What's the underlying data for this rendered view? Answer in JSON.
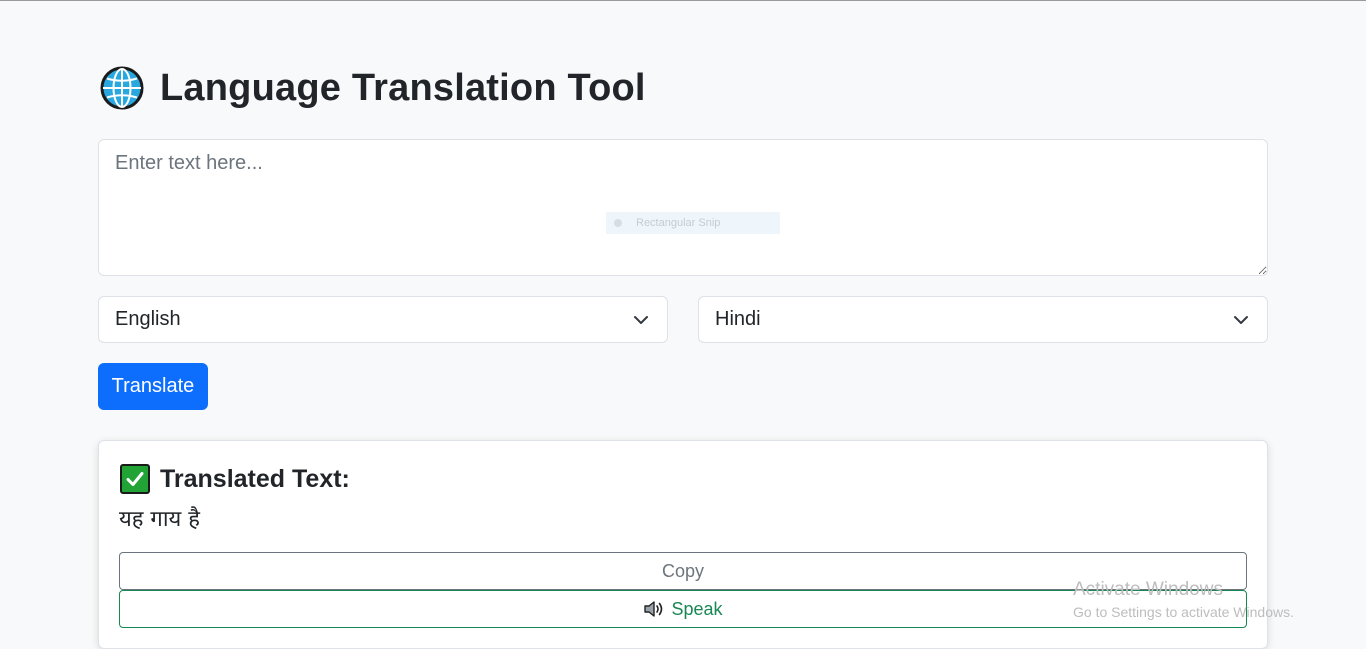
{
  "header": {
    "title": "Language Translation Tool",
    "icon": "globe-icon"
  },
  "input": {
    "placeholder": "Enter text here...",
    "value": ""
  },
  "snip_overlay": {
    "label": "Rectangular Snip"
  },
  "languages": {
    "source": "English",
    "target": "Hindi"
  },
  "actions": {
    "translate_label": "Translate"
  },
  "result": {
    "heading": "Translated Text:",
    "text": "यह गाय है",
    "copy_label": "Copy",
    "speak_label": "Speak"
  },
  "watermark": {
    "line1": "Activate Windows",
    "line2": "Go to Settings to activate Windows."
  },
  "colors": {
    "primary": "#0d6efd",
    "success": "#198754",
    "secondary": "#6c757d",
    "background": "#f8f9fa"
  }
}
